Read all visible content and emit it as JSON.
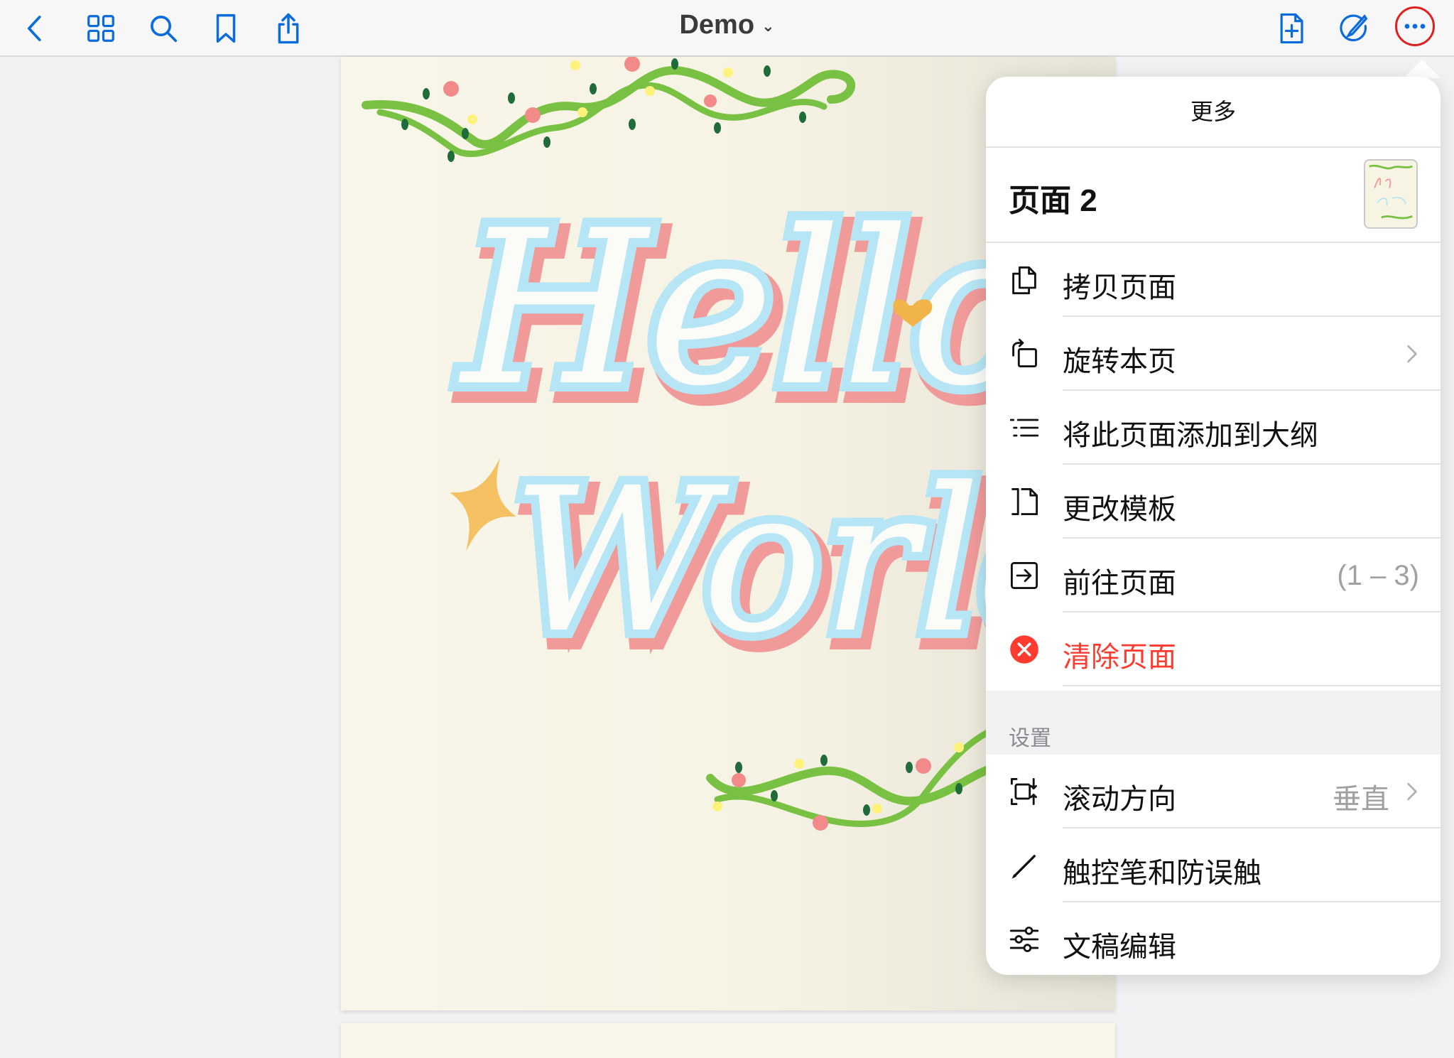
{
  "toolbar": {
    "title": "Demo",
    "left_icons": [
      "back-chevron-icon",
      "grid-icon",
      "search-icon",
      "bookmark-icon",
      "share-icon"
    ],
    "right_icons": [
      "add-page-icon",
      "markup-pen-icon",
      "more-ellipsis-icon"
    ]
  },
  "document": {
    "artwork_text": [
      "Hello",
      "World"
    ]
  },
  "popover": {
    "title": "更多",
    "current_page": "页面 2",
    "items": [
      {
        "label": "拷贝页面",
        "icon": "copy-page-icon"
      },
      {
        "label": "旋转本页",
        "icon": "rotate-page-icon",
        "chevron": true
      },
      {
        "label": "将此页面添加到大纲",
        "icon": "outline-list-icon"
      },
      {
        "label": "更改模板",
        "icon": "template-icon"
      },
      {
        "label": "前往页面",
        "icon": "go-to-page-icon",
        "value": "(1 – 3)"
      },
      {
        "label": "清除页面",
        "icon": "clear-page-icon",
        "destructive": true
      }
    ],
    "settings_header": "设置",
    "settings": [
      {
        "label": "滚动方向",
        "icon": "scroll-direction-icon",
        "value": "垂直",
        "chevron": true
      },
      {
        "label": "触控笔和防误触",
        "icon": "stylus-icon"
      },
      {
        "label": "文稿编辑",
        "icon": "sliders-icon"
      }
    ]
  },
  "colors": {
    "accent": "#0a6bdc",
    "destructive": "#ff3b30",
    "highlight_ring": "#e02020",
    "page_bg": "#f8f6e9",
    "vine_green": "#79c142",
    "letter_pink": "#f09a9a",
    "letter_blue": "#b6e6f5"
  }
}
